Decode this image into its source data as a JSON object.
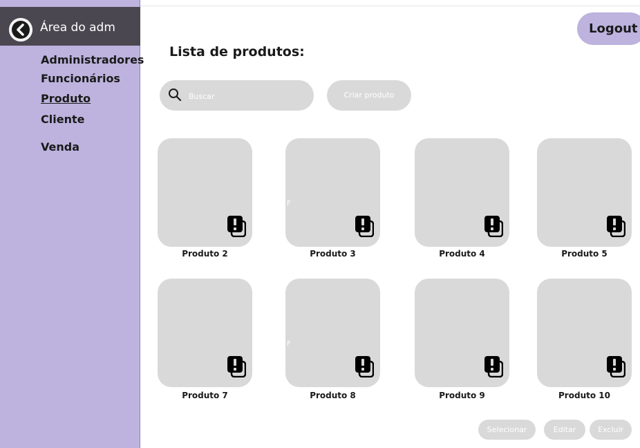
{
  "sidebar": {
    "title": "Área do adm",
    "items": [
      {
        "label": "Administradores",
        "active": false
      },
      {
        "label": "Funcionários",
        "active": false
      },
      {
        "label": "Produto",
        "active": true
      },
      {
        "label": "Cliente",
        "active": false
      },
      {
        "label": "Venda",
        "active": false
      }
    ]
  },
  "header": {
    "logout_label": "Logout",
    "title": "Lista de produtos:"
  },
  "search": {
    "placeholder": "Buscar",
    "icon": "search-icon"
  },
  "create_label": "Criar produto",
  "products": [
    {
      "name": "Produto 2",
      "icon": "alert-square-icon",
      "stray": ""
    },
    {
      "name": "Produto 3",
      "icon": "alert-square-icon",
      "stray": "F"
    },
    {
      "name": "Produto 4",
      "icon": "alert-square-icon",
      "stray": ""
    },
    {
      "name": "Produto 5",
      "icon": "alert-square-icon",
      "stray": ""
    },
    {
      "name": "Produto 7",
      "icon": "alert-square-icon",
      "stray": ""
    },
    {
      "name": "Produto 8",
      "icon": "alert-square-icon",
      "stray": "F"
    },
    {
      "name": "Produto 9",
      "icon": "alert-square-icon",
      "stray": ""
    },
    {
      "name": "Produto 10",
      "icon": "alert-square-icon",
      "stray": ""
    }
  ],
  "actions": {
    "select_label": "Selecionar",
    "edit_label": "Editar",
    "delete_label": "Excluir"
  },
  "colors": {
    "sidebar_bg": "#bdb3de",
    "sidebar_header_bg": "#4b4750",
    "placeholder_gray": "#d9d9d9",
    "text_dark": "#1a1a1a"
  }
}
